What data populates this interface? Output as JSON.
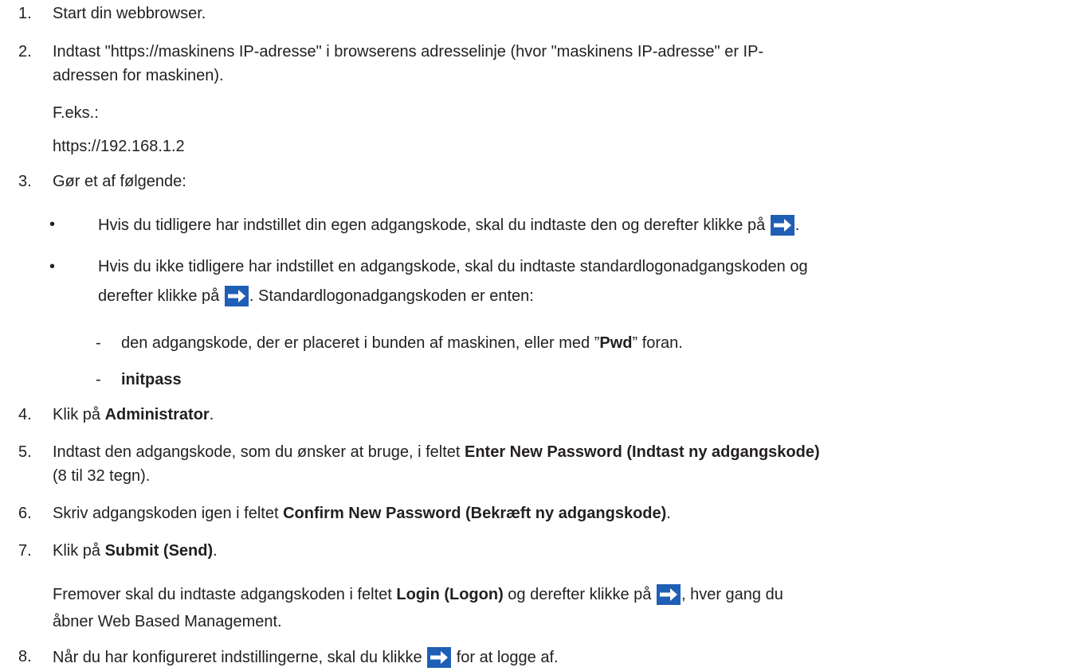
{
  "steps": {
    "s1": {
      "num": "1.",
      "text": "Start din webbrowser."
    },
    "s2": {
      "num": "2.",
      "line1": "Indtast \"https://maskinens IP-adresse\" i browserens adresselinje (hvor \"maskinens IP-adresse\" er IP-",
      "line2": "adressen for maskinen).",
      "example_label": "F.eks.:",
      "example_value": "https://192.168.1.2"
    },
    "s3": {
      "num": "3.",
      "text": "Gør et af følgende:",
      "bullet1": {
        "mark": "•",
        "before": "Hvis du tidligere har indstillet din egen adgangskode, skal du indtaste den og derefter klikke på",
        "after": "."
      },
      "bullet2": {
        "mark": "•",
        "line1": "Hvis du ikke tidligere har indstillet en adgangskode, skal du indtaste standardlogonadgangskoden og",
        "line2_before": "derefter klikke på",
        "line2_after": ". Standardlogonadgangskoden er enten:",
        "dash1": {
          "mark": "-",
          "before": "den adgangskode, der er placeret i bunden af maskinen, eller med ”",
          "bold": "Pwd",
          "after": "” foran."
        },
        "dash2": {
          "mark": "-",
          "bold": "initpass"
        }
      }
    },
    "s4": {
      "num": "4.",
      "before": "Klik på ",
      "bold": "Administrator",
      "after": "."
    },
    "s5": {
      "num": "5.",
      "before": "Indtast den adgangskode, som du ønsker at bruge, i feltet ",
      "bold": "Enter New Password (Indtast ny adgangskode)",
      "line2": "(8 til 32 tegn)."
    },
    "s6": {
      "num": "6.",
      "before": "Skriv adgangskoden igen i feltet ",
      "bold": "Confirm New Password (Bekræft ny adgangskode)",
      "after": "."
    },
    "s7": {
      "num": "7.",
      "before": "Klik på ",
      "bold": "Submit (Send)",
      "after": ".",
      "note_before": "Fremover skal du indtaste adgangskoden i feltet ",
      "note_bold": "Login (Logon)",
      "note_mid": " og derefter klikke på",
      "note_after": ", hver gang du",
      "note_line2": "åbner Web Based Management."
    },
    "s8": {
      "num": "8.",
      "before": "Når du har konfigureret indstillingerne, skal du klikke",
      "after": "for at logge af."
    }
  },
  "icon": {
    "name": "arrow-right-icon",
    "bg": "#1f5fb5",
    "fg": "#ffffff"
  }
}
